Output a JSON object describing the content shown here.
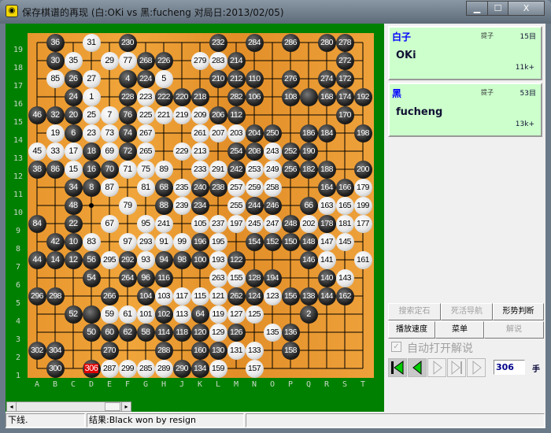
{
  "window": {
    "title": "保存棋谱的再现 (白:OKi vs 黑:fucheng  对局日:2013/02/05)",
    "minimize": "▁",
    "maximize": "☐",
    "close": "X"
  },
  "board": {
    "columns": [
      "A",
      "B",
      "C",
      "D",
      "E",
      "F",
      "G",
      "H",
      "J",
      "K",
      "L",
      "M",
      "N",
      "O",
      "P",
      "Q",
      "R",
      "S",
      "T"
    ],
    "rows_labels": [
      "19",
      "18",
      "17",
      "16",
      "15",
      "14",
      "13",
      "12",
      "11",
      "10",
      "9",
      "8",
      "7",
      "6",
      "5",
      "4",
      "3",
      "2",
      "1"
    ],
    "last_move": "306",
    "rows": {
      "19": "B:b:36 D:w:31 F:b:230 L:b:232 N:b:284 P:b:286 R:b:280 S:b:278",
      "18": "B:b:30 C:w:35 E:w:29 F:w:77 G:b:268 H:b:226 K:w:279 L:w:283 M:b:214 S:b:272",
      "17": "B:w:85 C:b:26 D:w:27 F:b:4 G:b:224 H:w:5 L:b:210 M:b:212 N:b:110 P:b:276 R:b:274 S:b:172",
      "16": "C:b:24 D:w:1 F:b:228 G:w:223 H:b:222 J:b:220 K:b:218 M:b:282 N:b:106 P:b:108 Q:b: R:b:168 S:b:174 T:b:192",
      "15": "A:b:46 B:b:32 C:b:20 D:w:25 E:w:7 F:b:76 G:w:225 H:w:221 J:w:219 K:w:209 L:b:206 M:b:112 S:b:170",
      "14": "B:w:19 C:b:6 D:w:23 E:w:73 F:b:74 G:w:267 K:w:261 L:w:207 M:w:203 N:b:204 O:b:250 Q:b:186 R:b:184 T:b:198",
      "13": "A:w:45 B:w:33 C:w:17 D:b:18 E:w:69 F:b:72 G:w:265 J:w:229 K:w:213 M:b:254 N:b:208 O:w:243 P:b:252 Q:b:190",
      "12": "A:b:38 B:b:86 C:w:15 D:b:16 E:b:70 F:w:71 G:w:75 H:w:89 K:w:233 L:w:291 M:b:242 N:w:253 O:w:249 P:b:256 Q:b:182 R:b:188 T:b:200",
      "11": "C:b:34 D:b:8 E:w:87 G:w:81 H:b:68 J:w:235 K:b:240 L:b:238 M:w:257 N:w:259 O:w:258 R:b:164 S:b:166 T:w:179",
      "10": "C:b:48 F:w:79 H:b:88 J:w:239 K:b:234 M:w:255 N:b:244 O:b:246 Q:b:66 R:w:163 S:w:165 T:w:199",
      "9": "A:b:84 C:b:22 E:w:67 G:w:95 H:w:241 K:w:105 L:w:237 M:w:197 N:w:245 O:w:247 P:b:248 Q:w:202 R:b:178 S:w:181 T:w:177",
      "8": "B:b:42 C:b:10 D:w:83 F:w:97 G:w:293 H:w:91 J:w:99 K:b:196 L:w:195 N:b:154 O:b:152 P:b:150 Q:b:148 R:w:147 S:w:145",
      "7": "A:b:44 B:b:14 C:b:12 D:b:56 E:w:295 F:b:292 G:w:93 H:b:94 J:b:98 K:b:100 L:w:193 M:b:122 Q:b:146 R:w:141 T:w:161",
      "6": "D:b:54 F:b:264 G:b:96 H:b:116 L:w:263 M:w:155 N:b:128 O:b:194 R:b:140 S:w:143",
      "5": "A:b:296 B:b:298 E:b:266 G:b:104 H:w:103 J:w:117 K:w:115 L:w:121 M:b:262 N:b:124 O:w:123 P:b:156 Q:b:138 R:b:144 S:b:162",
      "4": "C:b:52 D:b: E:w:59 F:w:61 G:w:101 H:b:102 J:w:113 K:b:64 L:w:119 M:w:127 N:w:125 Q:b:2",
      "3": "D:b:50 E:b:60 F:b:62 G:b:58 H:b:114 J:b:118 K:b:120 L:w:129 M:b:126 O:w:135 P:b:136",
      "2": "A:b:302 B:b:304 E:b:270 H:b:288 K:b:160 L:b:130 M:w:131 N:w:133 P:b:158",
      "1": "B:b:300 D:b:306 E:w:287 F:w:299 G:w:285 H:w:289 J:b:290 K:b:134 L:w:159 N:w:157"
    }
  },
  "players": {
    "white": {
      "side": "白子",
      "captured_label": "提子",
      "captured": "15目",
      "name": "OKi",
      "rank": "11k+"
    },
    "black": {
      "side": "黑",
      "captured_label": "提子",
      "captured": "53目",
      "name": "fucheng",
      "rank": "13k+"
    }
  },
  "buttons": {
    "search_joseki": "搜索定石",
    "life_death_nav": "死活导航",
    "position_judge": "形势判断",
    "play_speed": "播放速度",
    "menu": "菜单",
    "commentary": "解说"
  },
  "auto_commentary": {
    "label": "自动打开解说",
    "checked": true,
    "enabled": false
  },
  "navigation": {
    "move_number": "306",
    "move_unit": "手"
  },
  "status": {
    "left": "下线.",
    "result": "结果:Black won by resign",
    "right": ""
  },
  "colors": {
    "board": "#f0a53a",
    "background": "#008000",
    "card": "#ccffcc",
    "accent_nav": "#00cc00"
  }
}
